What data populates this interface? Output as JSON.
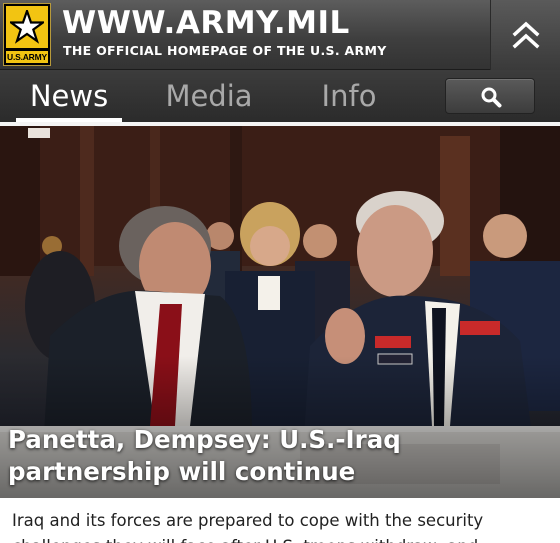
{
  "header": {
    "logo_text": "U.S.ARMY",
    "site_title": "WWW.ARMY.MIL",
    "site_subtitle": "THE OFFICIAL HOMEPAGE OF THE U.S. ARMY",
    "collapse_icon": "double-chevron-up-icon"
  },
  "nav": {
    "tabs": [
      {
        "label": "News",
        "active": true
      },
      {
        "label": "Media",
        "active": false
      },
      {
        "label": "Info",
        "active": false
      }
    ],
    "search_icon": "search-icon"
  },
  "hero": {
    "caption": "Panetta, Dempsey: U.S.-Iraq partnership will continue"
  },
  "article": {
    "summary": "Iraq and its forces are prepared to cope with the security challenges they will face after U.S. troops withdraw, and"
  },
  "colors": {
    "header_bg": "#4a4a4a",
    "nav_bg": "#333333",
    "active_tab": "#ffffff",
    "inactive_tab": "#a9a9a9",
    "logo_gold": "#f2c412"
  }
}
